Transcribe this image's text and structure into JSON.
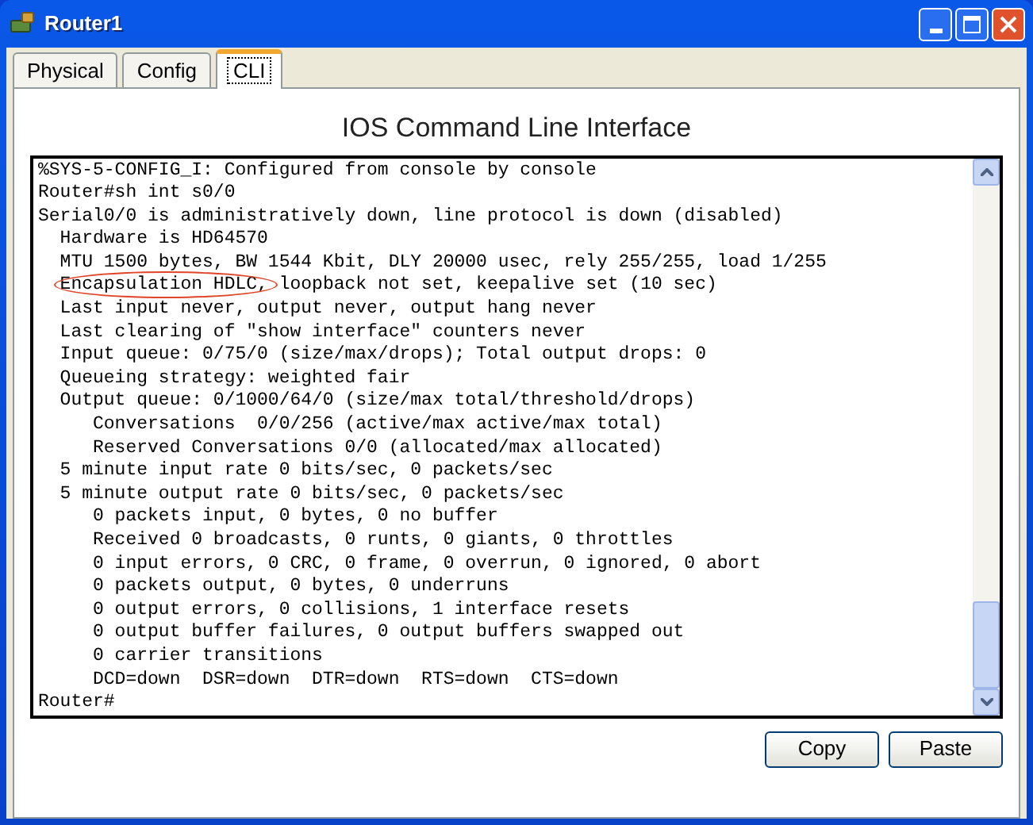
{
  "window": {
    "title": "Router1"
  },
  "tabs": [
    {
      "label": "Physical",
      "selected": false
    },
    {
      "label": "Config",
      "selected": false
    },
    {
      "label": "CLI",
      "selected": true
    }
  ],
  "heading": "IOS Command Line Interface",
  "console": {
    "lines": [
      {
        "text": "%SYS-5-CONFIG_I: Configured from console by console"
      },
      {
        "text": "Router#sh int s0/0"
      },
      {
        "text": "Serial0/0 is administratively down, line protocol is down (disabled)"
      },
      {
        "text": "  Hardware is HD64570"
      },
      {
        "text": "  MTU 1500 bytes, BW 1544 Kbit, DLY 20000 usec, rely 255/255, load 1/255"
      },
      {
        "circled": "  Encapsulation HDLC,",
        "text": " loopback not set, keepalive set (10 sec)"
      },
      {
        "text": "  Last input never, output never, output hang never"
      },
      {
        "text": "  Last clearing of \"show interface\" counters never"
      },
      {
        "text": "  Input queue: 0/75/0 (size/max/drops); Total output drops: 0"
      },
      {
        "text": "  Queueing strategy: weighted fair"
      },
      {
        "text": "  Output queue: 0/1000/64/0 (size/max total/threshold/drops)"
      },
      {
        "text": "     Conversations  0/0/256 (active/max active/max total)"
      },
      {
        "text": "     Reserved Conversations 0/0 (allocated/max allocated)"
      },
      {
        "text": "  5 minute input rate 0 bits/sec, 0 packets/sec"
      },
      {
        "text": "  5 minute output rate 0 bits/sec, 0 packets/sec"
      },
      {
        "text": "     0 packets input, 0 bytes, 0 no buffer"
      },
      {
        "text": "     Received 0 broadcasts, 0 runts, 0 giants, 0 throttles"
      },
      {
        "text": "     0 input errors, 0 CRC, 0 frame, 0 overrun, 0 ignored, 0 abort"
      },
      {
        "text": "     0 packets output, 0 bytes, 0 underruns"
      },
      {
        "text": "     0 output errors, 0 collisions, 1 interface resets"
      },
      {
        "text": "     0 output buffer failures, 0 output buffers swapped out"
      },
      {
        "text": "     0 carrier transitions"
      },
      {
        "text": "     DCD=down  DSR=down  DTR=down  RTS=down  CTS=down"
      },
      {
        "text": "Router#"
      }
    ]
  },
  "buttons": [
    "Copy",
    "Paste"
  ]
}
